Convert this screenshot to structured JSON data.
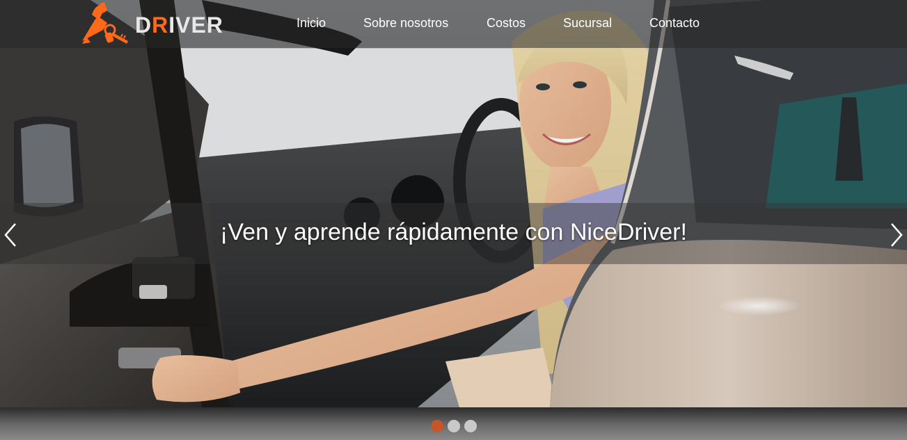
{
  "brand": {
    "logo_prefix": "D",
    "logo_accent": "R",
    "logo_suffix": "IVER",
    "accent_color": "#ff6a1a"
  },
  "nav": {
    "items": [
      {
        "label": "Inicio"
      },
      {
        "label": "Sobre nosotros"
      },
      {
        "label": "Costos"
      },
      {
        "label": "Sucursal"
      },
      {
        "label": "Contacto"
      }
    ]
  },
  "hero": {
    "caption": "¡Ven y aprende rápidamente con NiceDriver!",
    "image_icon": "woman-in-car-photo"
  },
  "carousel": {
    "prev_icon": "chevron-left-icon",
    "next_icon": "chevron-right-icon",
    "slide_count": 3,
    "active_index": 0,
    "active_color": "#c4562a",
    "inactive_color": "#c9c9c9"
  }
}
